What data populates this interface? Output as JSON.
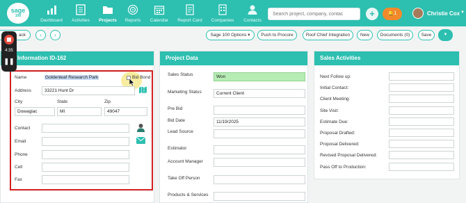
{
  "logo": {
    "line1": "sage",
    "line2": "100"
  },
  "nav": {
    "items": [
      {
        "label": "Dashboard",
        "icon": "bar-chart-icon"
      },
      {
        "label": "Activities",
        "icon": "checklist-icon"
      },
      {
        "label": "Projects",
        "icon": "folder-icon",
        "active": true
      },
      {
        "label": "Reports",
        "icon": "target-icon"
      },
      {
        "label": "Calendar",
        "icon": "calendar-icon"
      },
      {
        "label": "Report Card",
        "icon": "report-card-icon"
      },
      {
        "label": "Companies",
        "icon": "building-icon"
      },
      {
        "label": "Contacts",
        "icon": "person-icon"
      }
    ]
  },
  "search": {
    "placeholder": "Search project, company, contac"
  },
  "notifications": {
    "count": "1"
  },
  "user": {
    "name": "Christie Cox"
  },
  "toolbar": {
    "back_label": "ack",
    "sage_options": "Sage 100 Options",
    "push_procore": "Push to Procore",
    "roof_chief": "Roof Chief Integration",
    "new": "New",
    "documents": "Documents (0)",
    "save": "Save"
  },
  "recorder": {
    "time": "4:35"
  },
  "project_info": {
    "title": "ject Information ID-162",
    "name_label": "Name",
    "name_value": "Goldenleaf Research Park",
    "bid_bond_label": "Bid Bond",
    "address_label": "Address",
    "address_value": "33221 Hunt Dr",
    "city_label": "City",
    "city_value": "Dowagiac",
    "state_label": "State",
    "state_value": "MI",
    "zip_label": "Zip",
    "zip_value": "49047",
    "contact_label": "Contact",
    "email_label": "Email",
    "phone_label": "Phone",
    "cell_label": "Cell",
    "fax_label": "Fax"
  },
  "project_data": {
    "title": "Project Data",
    "fields": [
      {
        "label": "Sales Status",
        "value": "Won"
      },
      {
        "label": "Marketing Status",
        "value": "Current Client"
      },
      {
        "label": "Pre Bid",
        "value": ""
      },
      {
        "label": "Bid Date",
        "value": "11/19/2025"
      },
      {
        "label": "Lead Source",
        "value": ""
      },
      {
        "label": "Estimator",
        "value": ""
      },
      {
        "label": "Account Manager",
        "value": ""
      },
      {
        "label": "Take Off Person",
        "value": ""
      },
      {
        "label": "Products & Services",
        "value": ""
      }
    ]
  },
  "sales_activities": {
    "title": "Sales Activities",
    "fields": [
      {
        "label": "Next Follow up:"
      },
      {
        "label": "Initial Contact:"
      },
      {
        "label": "Client Meeting:"
      },
      {
        "label": "Site Visit:"
      },
      {
        "label": "Estimate Due:"
      },
      {
        "label": "Proposal Drafted:"
      },
      {
        "label": "Proposal Delivered:"
      },
      {
        "label": "Revised Proposal Delivered:"
      },
      {
        "label": "Pass Off to Production:"
      }
    ]
  },
  "colors": {
    "accent": "#2dbfb0",
    "won": "#b6edb4",
    "highlight": "#d21f1f",
    "notif": "#f28a2b"
  }
}
